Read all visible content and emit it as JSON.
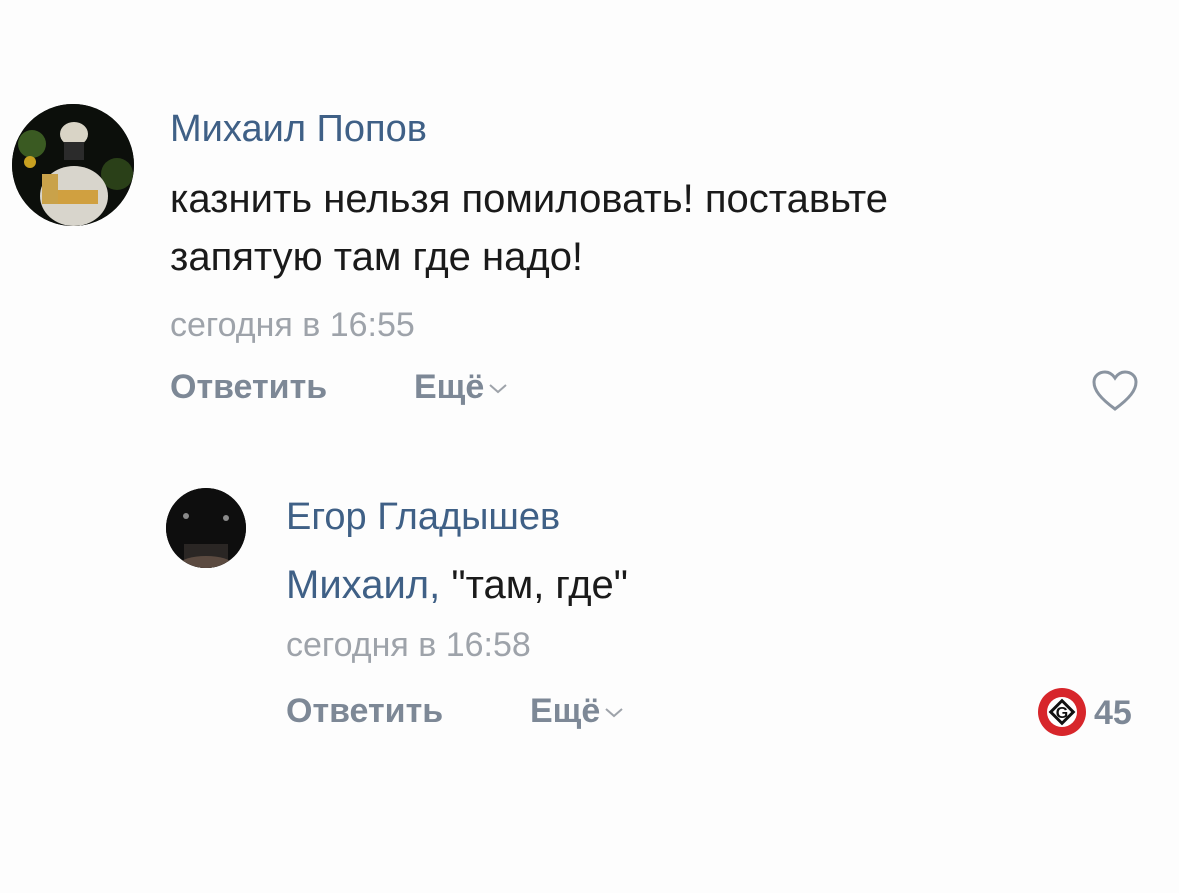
{
  "comments": [
    {
      "author": "Михаил Попов",
      "lines": [
        "казнить нельзя помиловать! поставьте",
        "запятую там где надо!"
      ],
      "time": "сегодня в 16:55",
      "reply_label": "Ответить",
      "more_label": "Ещё",
      "like_icon": "heart-outline-icon"
    },
    {
      "author": "Егор Гладышев",
      "mention": "Михаил,",
      "body": " \"там, где\"",
      "time": "сегодня в 16:58",
      "reply_label": "Ответить",
      "more_label": "Ещё",
      "like_icon": "grammar-nazi-badge-icon",
      "like_count": "45"
    }
  ],
  "colors": {
    "author": "#3f6086",
    "text": "#1a1a1a",
    "meta": "#9ea3aa",
    "action": "#7d8896",
    "badge_red": "#d7262b"
  }
}
